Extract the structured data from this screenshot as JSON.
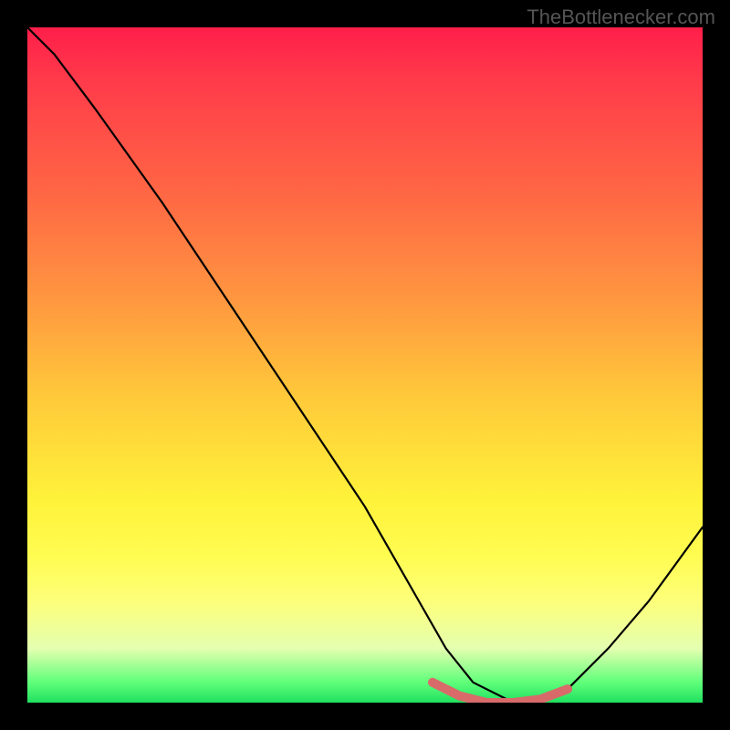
{
  "watermark": "TheBottlenecker.com",
  "chart_data": {
    "type": "line",
    "title": "",
    "xlabel": "",
    "ylabel": "",
    "xlim": [
      0,
      100
    ],
    "ylim": [
      0,
      100
    ],
    "series": [
      {
        "name": "main-curve",
        "x": [
          0,
          4,
          10,
          20,
          30,
          40,
          50,
          58,
          62,
          66,
          72,
          76,
          80,
          86,
          92,
          100
        ],
        "y": [
          100,
          96,
          88,
          74,
          59,
          44,
          29,
          15,
          8,
          3,
          0,
          0,
          2,
          8,
          15,
          26
        ]
      },
      {
        "name": "green-band",
        "x": [
          60,
          64,
          68,
          72,
          76,
          80
        ],
        "y": [
          3,
          1,
          0,
          0,
          0.5,
          2
        ]
      }
    ],
    "colors": {
      "main_curve": "#000000",
      "green_band": "#d86a6a",
      "bg_top": "#ff1e4a",
      "bg_mid": "#fff23a",
      "bg_bottom": "#20e060"
    }
  }
}
